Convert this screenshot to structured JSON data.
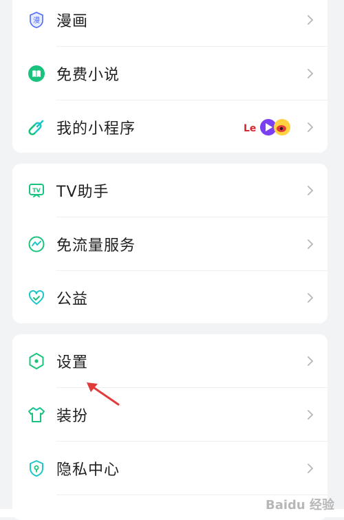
{
  "groups": [
    {
      "items": [
        {
          "label": "漫画",
          "icon": "comic-icon"
        },
        {
          "label": "免费小说",
          "icon": "book-icon"
        },
        {
          "label": "我的小程序",
          "icon": "mini-program-icon",
          "badge": "Le"
        }
      ]
    },
    {
      "items": [
        {
          "label": "TV助手",
          "icon": "tv-icon"
        },
        {
          "label": "免流量服务",
          "icon": "data-free-icon"
        },
        {
          "label": "公益",
          "icon": "charity-heart-icon"
        }
      ]
    },
    {
      "items": [
        {
          "label": "设置",
          "icon": "settings-hex-icon"
        },
        {
          "label": "装扮",
          "icon": "shirt-icon"
        },
        {
          "label": "隐私中心",
          "icon": "privacy-shield-icon"
        }
      ]
    }
  ],
  "watermark": "Baidu 经验",
  "colors": {
    "accent_green": "#19c37d",
    "accent_teal": "#1ec6c6",
    "arrow_red": "#e03a3a"
  }
}
